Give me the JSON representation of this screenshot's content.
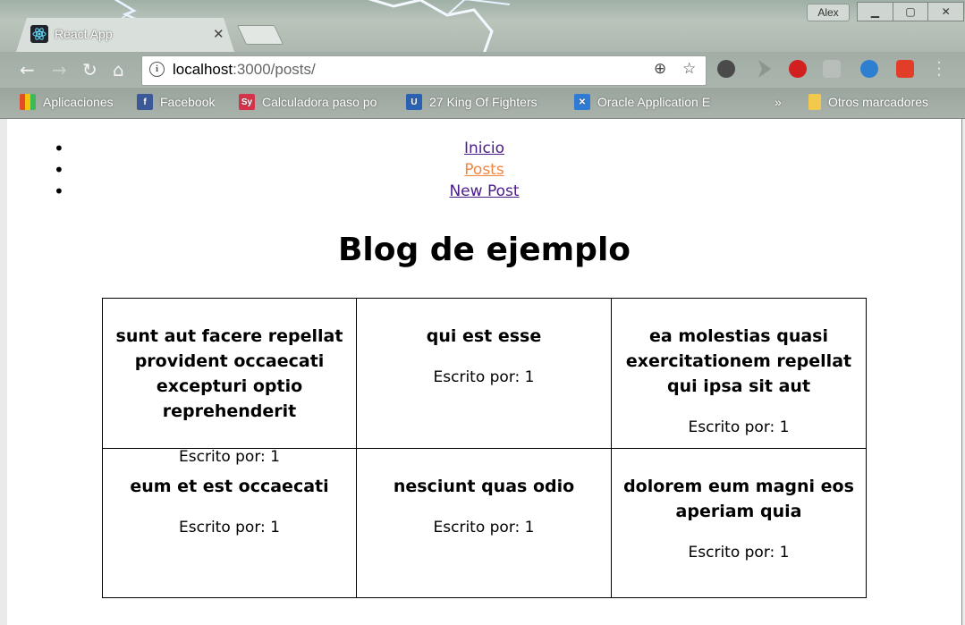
{
  "browser": {
    "tab_title": "React App",
    "user": "Alex",
    "url_host": "localhost",
    "url_path": ":3000/posts/",
    "bookmarks": [
      {
        "label": "Aplicaciones",
        "icon": "apps-grid-icon",
        "color": "#e34c26"
      },
      {
        "label": "Facebook",
        "icon": "facebook-icon",
        "color": "#3b5998"
      },
      {
        "label": "Calculadora paso po",
        "icon": "symbolab-icon",
        "color": "#d6334a"
      },
      {
        "label": "27 King Of Fighters",
        "icon": "bookmark-u-icon",
        "color": "#2a62b3"
      },
      {
        "label": "Oracle Application E",
        "icon": "oracle-apex-icon",
        "color": "#2e7bd6"
      }
    ],
    "more_bookmarks": "»",
    "other_bookmarks": "Otros marcadores"
  },
  "nav": {
    "items": [
      {
        "label": "Inicio",
        "active": false
      },
      {
        "label": "Posts",
        "active": true
      },
      {
        "label": "New Post",
        "active": false
      }
    ]
  },
  "page": {
    "title": "Blog de ejemplo"
  },
  "posts": [
    {
      "title": "sunt aut facere repellat provident occaecati excepturi optio reprehenderit",
      "author": "Escrito por: 1"
    },
    {
      "title": "qui est esse",
      "author": "Escrito por: 1"
    },
    {
      "title": "ea molestias quasi exercitationem repellat qui ipsa sit aut",
      "author": "Escrito por: 1"
    },
    {
      "title": "eum et est occaecati",
      "author": "Escrito por: 1"
    },
    {
      "title": "nesciunt quas odio",
      "author": "Escrito por: 1"
    },
    {
      "title": "dolorem eum magni eos aperiam quia",
      "author": "Escrito por: 1"
    }
  ],
  "colors": {
    "link": "#4b1a8b",
    "active_link": "#f0863f"
  }
}
